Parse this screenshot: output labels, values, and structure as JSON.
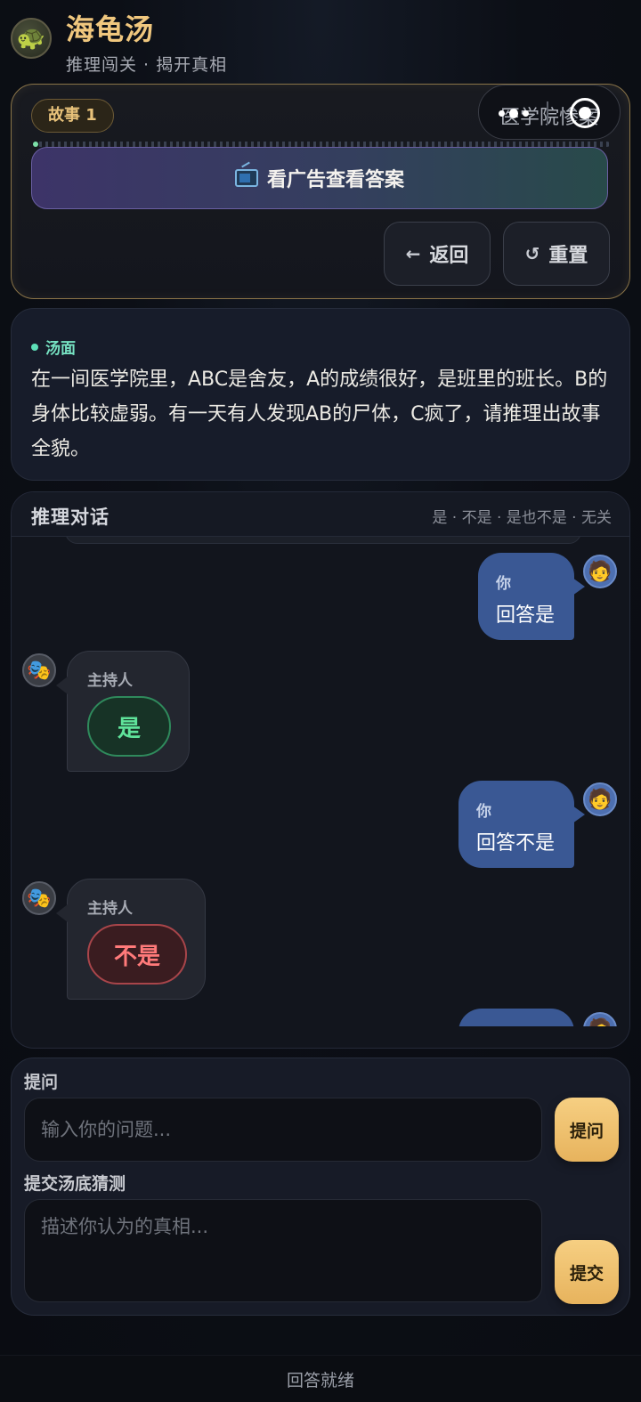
{
  "app": {
    "logo_icon": "turtle-icon",
    "title": "海龟汤",
    "subtitle": "推理闯关 · 揭开真相"
  },
  "story": {
    "badge": "故事 1",
    "name": "医学院惨案",
    "progress": 0.01,
    "ad_button": "看广告查看答案",
    "ad_icon": "tv-icon",
    "back_label": "返回",
    "back_icon": "arrow-left-icon",
    "reset_label": "重置",
    "reset_icon": "reset-icon"
  },
  "scenario": {
    "label": "汤面",
    "text": "在一间医学院里，ABC是舍友，A的成绩很好，是班里的班长。B的身体比较虚弱。有一天有人发现AB的尸体，C疯了，请推理出故事全貌。"
  },
  "dialog": {
    "title": "推理对话",
    "legend": "是 · 不是 · 是也不是 · 无关",
    "messages": [
      {
        "role": "user",
        "who": "你",
        "text": "回答是"
      },
      {
        "role": "host",
        "who": "主持人",
        "verdict": "是",
        "verdict_type": "yes"
      },
      {
        "role": "user",
        "who": "你",
        "text": "回答不是"
      },
      {
        "role": "host",
        "who": "主持人",
        "verdict": "不是",
        "verdict_type": "no"
      }
    ]
  },
  "ask": {
    "label": "提问",
    "placeholder": "输入你的问题...",
    "button": "提问"
  },
  "guess": {
    "label": "提交汤底猜测",
    "placeholder": "描述你认为的真相...",
    "button": "提交"
  },
  "status": "回答就绪",
  "colors": {
    "accent_gold": "#f0c77e",
    "yes_green": "#5fe39a",
    "no_red": "#ff7a7a",
    "user_bubble": "#3a5894"
  }
}
